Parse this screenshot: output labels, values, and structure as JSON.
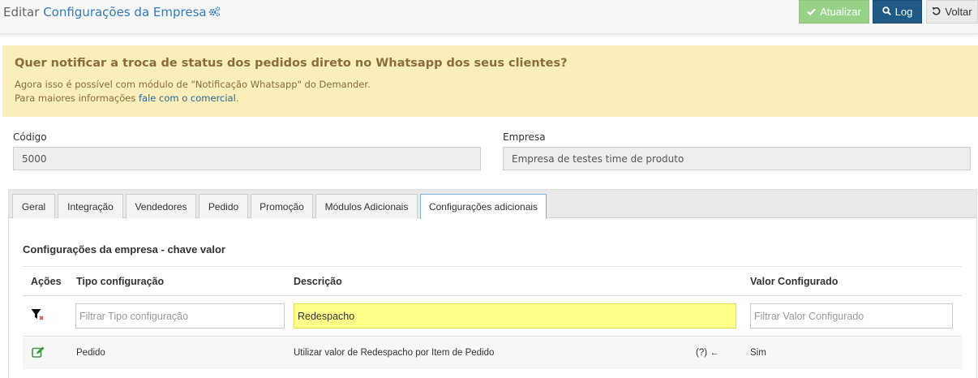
{
  "header": {
    "title_prefix": "Editar ",
    "title_main": "Configurações da Empresa",
    "buttons": {
      "atualizar": "Atualizar",
      "log": "Log",
      "voltar": "Voltar"
    }
  },
  "alert": {
    "title": "Quer notificar a troca de status dos pedidos direto no Whatsapp dos seus clientes?",
    "line1": "Agora isso é possível com módulo de \"Notificação Whatsapp\" do Demander.",
    "line2_prefix": "Para maiores informações ",
    "line2_link": "fale com o comercial",
    "line2_suffix": "."
  },
  "form": {
    "codigo_label": "Código",
    "codigo_value": "5000",
    "empresa_label": "Empresa",
    "empresa_value": "Empresa de testes time de produto"
  },
  "tabs": [
    {
      "label": "Geral"
    },
    {
      "label": "Integração"
    },
    {
      "label": "Vendedores"
    },
    {
      "label": "Pedido"
    },
    {
      "label": "Promoção"
    },
    {
      "label": "Módulos Adicionais"
    },
    {
      "label": "Configurações adicionais",
      "active": true
    }
  ],
  "section": {
    "title": "Configurações da empresa - chave valor",
    "columns": {
      "acoes": "Ações",
      "tipo": "Tipo configuração",
      "descricao": "Descrição",
      "valor": "Valor Configurado"
    },
    "filters": {
      "tipo_placeholder": "Filtrar Tipo configuração",
      "descricao_value": "Redespacho",
      "valor_placeholder": "Filtrar Valor Configurado"
    },
    "rows": [
      {
        "tipo": "Pedido",
        "descricao": "Utilizar valor de Redespacho por Item de Pedido",
        "help": "(?) ←",
        "valor": "Sim"
      }
    ]
  },
  "colors": {
    "accent": "#337ab7",
    "success": "#96d288",
    "primary_dark": "#1f5a87",
    "alert_bg": "#faeeba",
    "alert_text": "#8a6d3b",
    "highlight": "#ffff8a",
    "edit_icon": "#3c9a3c",
    "clear_filter_mark": "#d9534f"
  },
  "icons": {
    "title": "gears-icon",
    "atualizar": "check-icon",
    "log": "search-icon",
    "voltar": "undo-icon",
    "clear_filter": "filter-clear-icon",
    "edit": "edit-icon"
  }
}
